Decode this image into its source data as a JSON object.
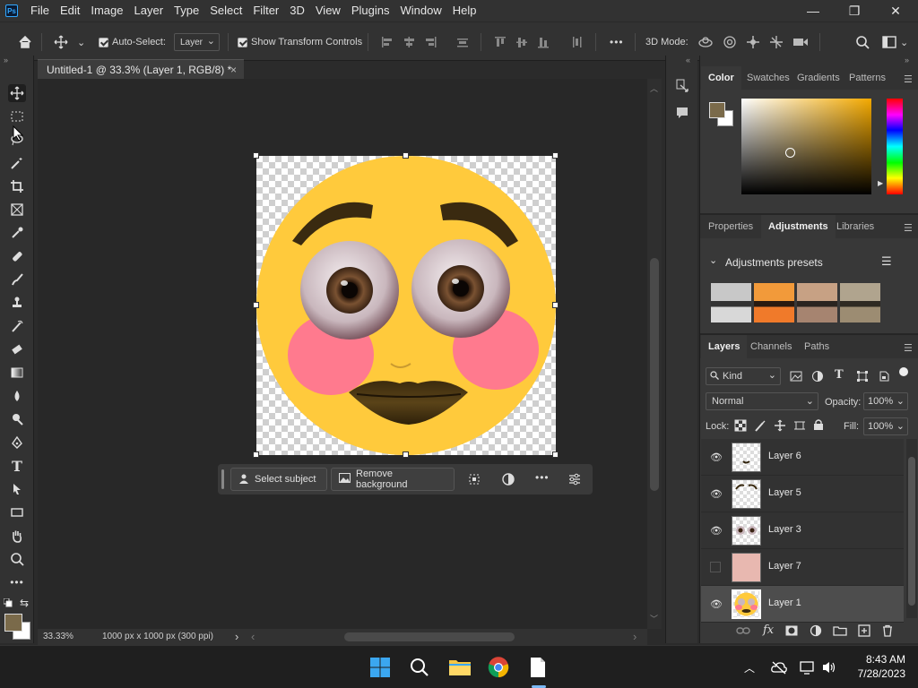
{
  "app": {
    "logo_text": "Ps",
    "menu": [
      "File",
      "Edit",
      "Image",
      "Layer",
      "Type",
      "Select",
      "Filter",
      "3D",
      "View",
      "Plugins",
      "Window",
      "Help"
    ]
  },
  "options": {
    "auto_select_label": "Auto-Select:",
    "auto_select_value": "Layer",
    "show_transform_label": "Show Transform Controls",
    "mode_label": "3D Mode:",
    "more": "•••"
  },
  "document": {
    "tab_title": "Untitled-1 @ 33.3% (Layer 1, RGB/8) *",
    "close": "×",
    "zoom": "33.33%",
    "doc_info": "1000 px x 1000 px (300 ppi)",
    "info_arrow": "›"
  },
  "context_bar": {
    "select_subject": "Select subject",
    "remove_background": "Remove background",
    "more": "•••"
  },
  "panels": {
    "color_tabs": [
      "Color",
      "Swatches",
      "Gradients",
      "Patterns"
    ],
    "props_tabs": [
      "Properties",
      "Adjustments",
      "Libraries"
    ],
    "adjustments_title": "Adjustments presets",
    "layers_tabs": [
      "Layers",
      "Channels",
      "Paths"
    ],
    "kind_label": "Kind",
    "blend_mode": "Normal",
    "opacity_label": "Opacity:",
    "opacity_value": "100%",
    "lock_label": "Lock:",
    "fill_label": "Fill:",
    "fill_value": "100%",
    "layers": [
      {
        "name": "Layer 6",
        "visible": true,
        "selected": false
      },
      {
        "name": "Layer 5",
        "visible": true,
        "selected": false
      },
      {
        "name": "Layer 3",
        "visible": true,
        "selected": false
      },
      {
        "name": "Layer 7",
        "visible": false,
        "selected": false
      },
      {
        "name": "Layer 1",
        "visible": true,
        "selected": true
      }
    ],
    "footer_fx": "fx"
  },
  "colors": {
    "foreground": "#7a6a4a",
    "background": "#ffffff",
    "emoji_yellow": "#ffca3c",
    "blush": "#ff7a8e",
    "accent_blue": "#31a8ff"
  },
  "system": {
    "time": "8:43 AM",
    "date": "7/28/2023"
  }
}
